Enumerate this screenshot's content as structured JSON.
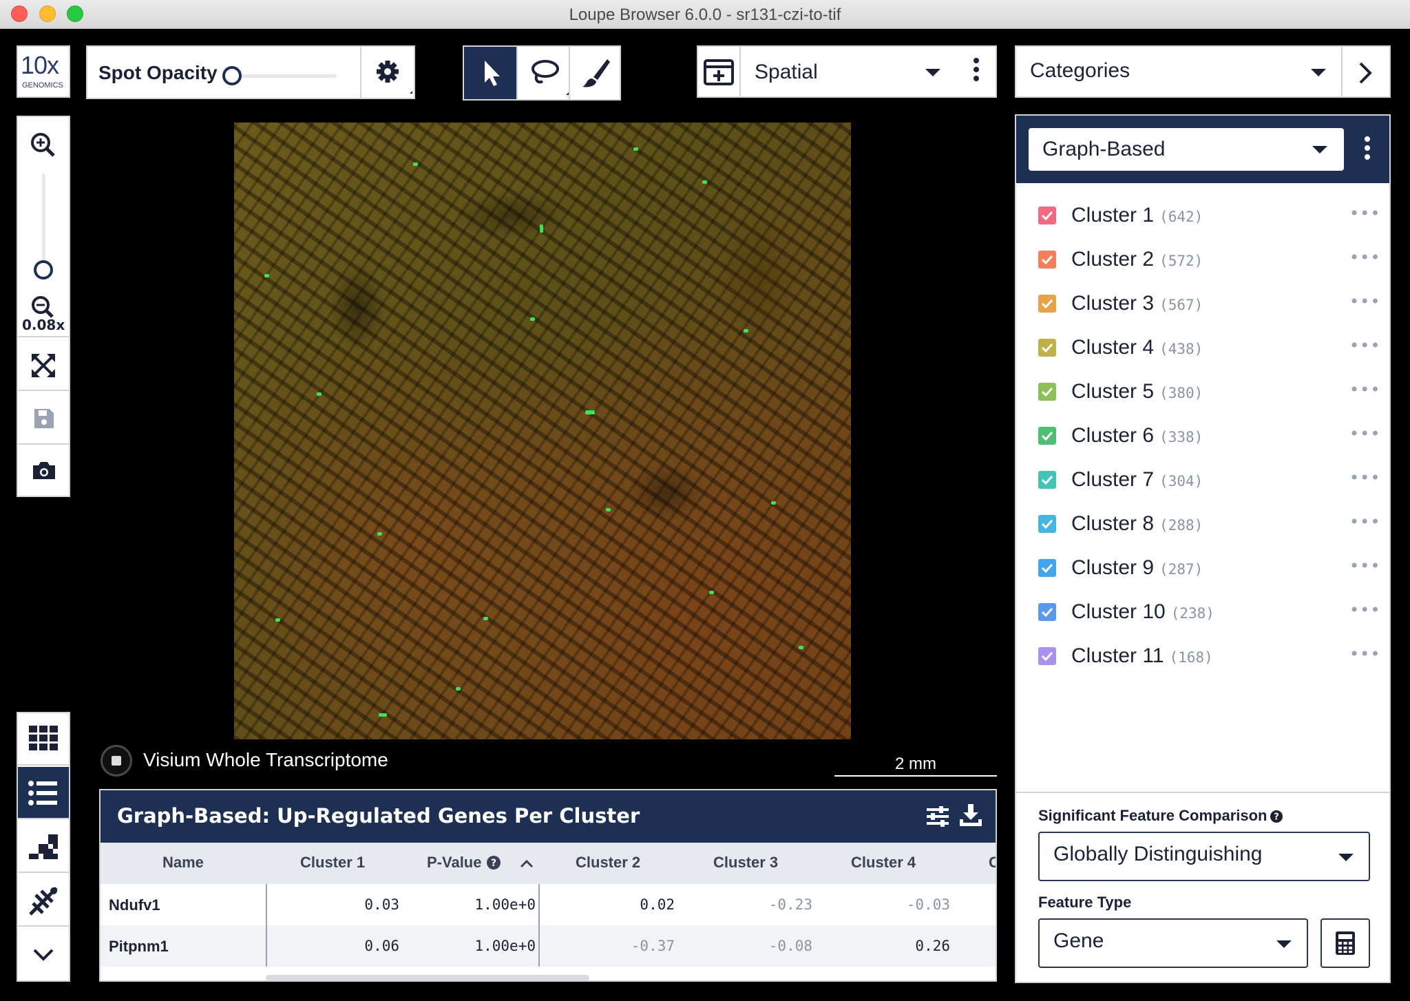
{
  "window": {
    "title": "Loupe Browser 6.0.0 - sr131-czi-to-tif"
  },
  "logo": {
    "big": "10x",
    "small": "GENOMICS"
  },
  "toolbar": {
    "spot_opacity_label": "Spot Opacity",
    "spot_opacity_value": 0.0,
    "view_mode": "Spatial",
    "categories_label": "Categories"
  },
  "zoom": {
    "level": "0.08x"
  },
  "image": {
    "assay_label": "Visium Whole Transcriptome",
    "scale_bar": "2 mm"
  },
  "table": {
    "title": "Graph-Based: Up-Regulated Genes Per Cluster",
    "columns": [
      "Name",
      "Cluster 1",
      "P-Value",
      "Cluster 2",
      "Cluster 3",
      "Cluster 4",
      "C"
    ],
    "rows": [
      {
        "name": "Ndufv1",
        "c1": "0.03",
        "pval": "1.00e+0",
        "c2": "0.02",
        "c3": "-0.23",
        "c4": "-0.03"
      },
      {
        "name": "Pitpnm1",
        "c1": "0.06",
        "pval": "1.00e+0",
        "c2": "-0.37",
        "c3": "-0.08",
        "c4": "0.26"
      }
    ]
  },
  "clusters_panel": {
    "clustering": "Graph-Based",
    "clusters": [
      {
        "name": "Cluster 1",
        "count": "(642)",
        "color": "#f06a82"
      },
      {
        "name": "Cluster 2",
        "count": "(572)",
        "color": "#f3805a"
      },
      {
        "name": "Cluster 3",
        "count": "(567)",
        "color": "#e6a44a"
      },
      {
        "name": "Cluster 4",
        "count": "(438)",
        "color": "#bfb04a"
      },
      {
        "name": "Cluster 5",
        "count": "(380)",
        "color": "#8cc05a"
      },
      {
        "name": "Cluster 6",
        "count": "(338)",
        "color": "#4fbf74"
      },
      {
        "name": "Cluster 7",
        "count": "(304)",
        "color": "#44c4b4"
      },
      {
        "name": "Cluster 8",
        "count": "(288)",
        "color": "#46b6e0"
      },
      {
        "name": "Cluster 9",
        "count": "(287)",
        "color": "#44a4ee"
      },
      {
        "name": "Cluster 10",
        "count": "(238)",
        "color": "#5a98ee"
      },
      {
        "name": "Cluster 11",
        "count": "(168)",
        "color": "#ab90ee"
      }
    ],
    "sig_feature_label": "Significant Feature Comparison",
    "sig_feature_value": "Globally Distinguishing",
    "feature_type_label": "Feature Type",
    "feature_type_value": "Gene"
  },
  "colors": {
    "navy": "#1d2f52",
    "border": "#d0d3d8"
  }
}
